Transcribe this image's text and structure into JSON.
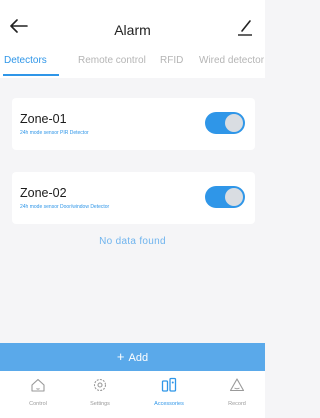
{
  "header": {
    "title": "Alarm",
    "back_icon": "back-arrow-icon",
    "edit_icon": "edit-icon"
  },
  "tabs": [
    {
      "label": "Detectors",
      "active": true
    },
    {
      "label": "Remote control",
      "active": false
    },
    {
      "label": "RFID",
      "active": false
    },
    {
      "label": "Wired detector",
      "active": false
    }
  ],
  "zones": [
    {
      "name": "Zone-01",
      "subtitle": "24h mode sensor PIR Detector",
      "enabled": true
    },
    {
      "name": "Zone-02",
      "subtitle": "24h mode sensor Door/window Detector",
      "enabled": true
    }
  ],
  "empty_message": "No data found",
  "add_button": {
    "label": "Add",
    "icon": "plus-icon"
  },
  "bottom_nav": [
    {
      "label": "Control",
      "icon": "home-icon",
      "active": false
    },
    {
      "label": "Settings",
      "icon": "gear-icon",
      "active": false
    },
    {
      "label": "Accessories",
      "icon": "accessories-icon",
      "active": true
    },
    {
      "label": "Record",
      "icon": "warning-icon",
      "active": false
    }
  ],
  "colors": {
    "accent": "#2f96e8",
    "add_bar": "#5aa9ea",
    "background": "#f5f5f7"
  }
}
